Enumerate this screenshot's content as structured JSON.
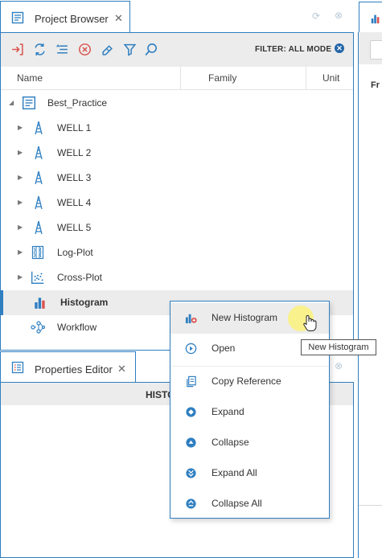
{
  "project_browser": {
    "tab_title": "Project Browser",
    "filter_label": "FILTER: ALL MODE",
    "columns": [
      "Name",
      "Family",
      "Unit"
    ],
    "tree": {
      "root": "Best_Practice",
      "wells": [
        "WELL 1",
        "WELL 2",
        "WELL 3",
        "WELL 4",
        "WELL 5"
      ],
      "log_plot": "Log-Plot",
      "cross_plot": "Cross-Plot",
      "histogram": "Histogram",
      "workflow": "Workflow"
    }
  },
  "properties_editor": {
    "tab_title": "Properties Editor",
    "header": "HISTO"
  },
  "right_panel": {
    "label": "Fr"
  },
  "context_menu": {
    "items": [
      "New Histogram",
      "Open",
      "Copy Reference",
      "Expand",
      "Collapse",
      "Expand All",
      "Collapse All"
    ]
  },
  "tooltip": "New Histogram",
  "colors": {
    "accent": "#2f7fc1",
    "toolbar_bg": "#ececec",
    "selected_bg": "#ececec"
  }
}
